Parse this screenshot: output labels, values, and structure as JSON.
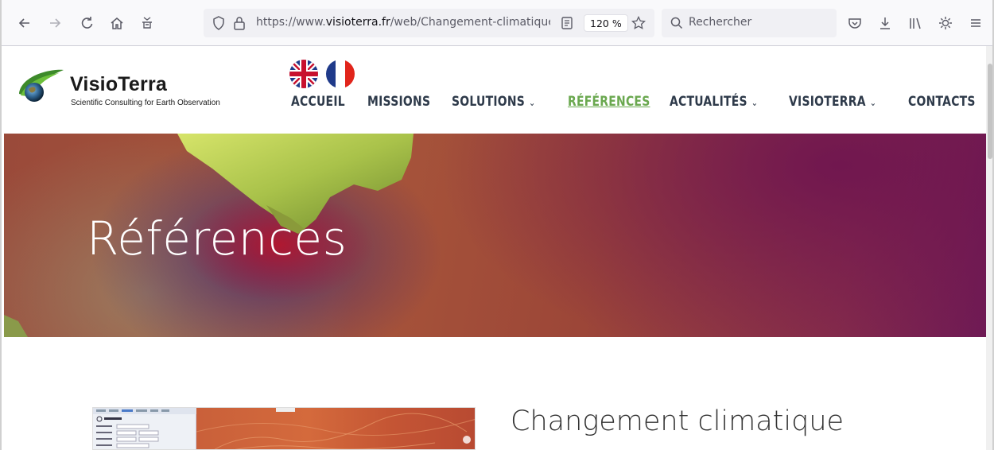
{
  "browser": {
    "url_prefix": "https://www.",
    "url_domain": "visioterra.fr",
    "url_path": "/web/Changement-climatique",
    "zoom": "120 %",
    "search_placeholder": "Rechercher"
  },
  "site": {
    "logo_title": "VisioTerra",
    "logo_subtitle": "Scientific Consulting for Earth Observation",
    "nav": [
      {
        "label": "ACCUEIL"
      },
      {
        "label": "MISSIONS"
      },
      {
        "label": "SOLUTIONS"
      },
      {
        "label": "RÉFÉRENCES"
      },
      {
        "label": "ACTUALITÉS"
      },
      {
        "label": "VISIOTERRA"
      },
      {
        "label": "CONTACTS"
      }
    ]
  },
  "hero": {
    "title": "Références"
  },
  "content": {
    "title": "Changement climatique"
  },
  "colors": {
    "nav_text": "#2e3a4a",
    "nav_active": "#6aa84f"
  }
}
